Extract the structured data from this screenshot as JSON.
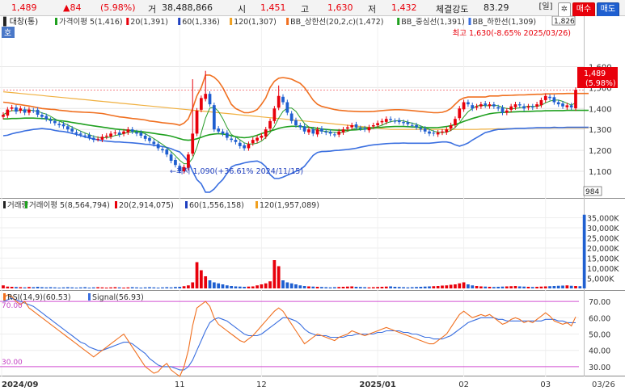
{
  "header": {
    "price": "1,489",
    "change": "▲84",
    "change_pct": "(5.98%)",
    "volume_label": "거",
    "volume": "38,488,866",
    "open_label": "시",
    "open": "1,451",
    "high_label": "고",
    "high": "1,630",
    "low_label": "저",
    "low": "1,432",
    "strength_label": "체결강도",
    "strength": "83.29",
    "period_button": "[일]",
    "buy_button": "매수",
    "sell_button": "매도"
  },
  "price_panel": {
    "title": "대창(통)",
    "quote_tag": "호",
    "legend": [
      {
        "text": "가격이평 5(1,416)",
        "color": "#1fa01f"
      },
      {
        "text": "20(1,391)",
        "color": "#e8000b"
      },
      {
        "text": "60(1,336)",
        "color": "#1f3fbf"
      },
      {
        "text": "120(1,307)",
        "color": "#f0a020"
      },
      {
        "text": "BB_상한선(20,2,c)(1,472)",
        "color": "#f07020"
      },
      {
        "text": "BB_중심선(1,391)",
        "color": "#1fa01f"
      },
      {
        "text": "BB_하한선(1,309)",
        "color": "#3a6fe0"
      }
    ],
    "max_annotation": "최고 1,630(-8.65% 2025/03/26)",
    "min_annotation": "최저 1,090(+36.61% 2024/11/15)",
    "axis_top_badge": "1,826",
    "axis_bottom_badge": "984",
    "current_price_badge": "1,489",
    "current_pct_badge": "(5.98%)"
  },
  "volume_panel": {
    "legend": [
      {
        "text": "거래량",
        "color": "#222222"
      },
      {
        "text": "거래이평 5(8,564,794)",
        "color": "#1fa01f"
      },
      {
        "text": "20(2,914,075)",
        "color": "#e8000b"
      },
      {
        "text": "60(1,556,158)",
        "color": "#1f3fbf"
      },
      {
        "text": "120(1,957,089)",
        "color": "#f0a020"
      }
    ],
    "ticks": [
      "35,000K",
      "30,000K",
      "25,000K",
      "20,000K",
      "15,000K",
      "10,000K",
      "5,000K"
    ]
  },
  "rsi_panel": {
    "legend": [
      {
        "text": "RSI(14,9)(60.53)",
        "color": "#f07020"
      },
      {
        "text": "Signal(56.93)",
        "color": "#3a6fe0"
      }
    ],
    "ticks": [
      "70.00",
      "60.00",
      "50.00",
      "40.00",
      "30.00"
    ],
    "left_labels": [
      "70.00",
      "30.00"
    ]
  },
  "x_labels": [
    "2024/09",
    "11",
    "12",
    "2025/01",
    "02",
    "03"
  ],
  "x_end_label": "03/26",
  "chart_data": [
    {
      "type": "candlestick",
      "title": "대창(통)",
      "ylim": [
        984,
        1826
      ],
      "yticks": [
        1100,
        1200,
        1300,
        1400,
        1500,
        1600
      ],
      "close": [
        1370,
        1395,
        1405,
        1385,
        1400,
        1380,
        1395,
        1390,
        1370,
        1360,
        1350,
        1340,
        1330,
        1320,
        1315,
        1300,
        1290,
        1280,
        1275,
        1270,
        1260,
        1250,
        1255,
        1265,
        1270,
        1280,
        1285,
        1275,
        1290,
        1300,
        1290,
        1280,
        1270,
        1255,
        1245,
        1230,
        1210,
        1200,
        1180,
        1150,
        1130,
        1100,
        1120,
        1180,
        1280,
        1390,
        1450,
        1470,
        1420,
        1300,
        1290,
        1280,
        1260,
        1250,
        1240,
        1220,
        1210,
        1230,
        1250,
        1260,
        1270,
        1300,
        1340,
        1400,
        1460,
        1430,
        1380,
        1340,
        1320,
        1310,
        1290,
        1300,
        1280,
        1300,
        1290,
        1285,
        1280,
        1275,
        1290,
        1300,
        1310,
        1320,
        1310,
        1305,
        1300,
        1310,
        1320,
        1330,
        1340,
        1350,
        1345,
        1340,
        1335,
        1330,
        1325,
        1320,
        1310,
        1300,
        1290,
        1280,
        1280,
        1285,
        1290,
        1300,
        1320,
        1350,
        1400,
        1430,
        1420,
        1400,
        1410,
        1420,
        1415,
        1420,
        1410,
        1400,
        1380,
        1390,
        1410,
        1420,
        1415,
        1400,
        1410,
        1405,
        1420,
        1440,
        1460,
        1450,
        1430,
        1420,
        1410,
        1415,
        1405,
        1489
      ],
      "highs": [
        [
          44,
          1540
        ],
        [
          47,
          1580
        ],
        [
          64,
          1510
        ],
        [
          138,
          1630
        ]
      ],
      "lows": [
        [
          41,
          1090
        ]
      ]
    },
    {
      "type": "line",
      "name_list": [
        "BB_상한선",
        "BB_중심선",
        "BB_하한선",
        "120"
      ],
      "bb_upper": [
        1430,
        1428,
        1425,
        1420,
        1418,
        1415,
        1412,
        1408,
        1404,
        1400,
        1398,
        1396,
        1395,
        1392,
        1390,
        1388,
        1385,
        1384,
        1383,
        1382,
        1381,
        1380,
        1378,
        1376,
        1372,
        1368,
        1364,
        1360,
        1358,
        1355,
        1352,
        1350,
        1348,
        1345,
        1340,
        1338,
        1335,
        1332,
        1330,
        1328,
        1325,
        1320,
        1330,
        1350,
        1400,
        1460,
        1500,
        1560,
        1560,
        1550,
        1530,
        1500,
        1460,
        1420,
        1400,
        1390,
        1380,
        1380,
        1385,
        1395,
        1420,
        1450,
        1500,
        1530,
        1545,
        1548,
        1545,
        1540,
        1530,
        1520,
        1500,
        1470,
        1440,
        1420,
        1410,
        1405,
        1400,
        1395,
        1392,
        1390,
        1388,
        1387,
        1386,
        1385,
        1385,
        1385,
        1386,
        1388,
        1390,
        1392,
        1393,
        1394,
        1394,
        1393,
        1392,
        1390,
        1388,
        1386,
        1384,
        1382,
        1380,
        1380,
        1382,
        1388,
        1400,
        1420,
        1440,
        1450,
        1455,
        1455,
        1455,
        1455,
        1455,
        1460,
        1460,
        1460,
        1462,
        1462,
        1463,
        1464,
        1465,
        1465,
        1466,
        1467,
        1468,
        1468,
        1470,
        1470,
        1470,
        1471,
        1471,
        1472,
        1472,
        1472,
        1472,
        1472,
        1472
      ],
      "bb_middle": [
        1350,
        1350,
        1352,
        1352,
        1353,
        1354,
        1354,
        1354,
        1353,
        1352,
        1350,
        1348,
        1345,
        1342,
        1340,
        1337,
        1333,
        1330,
        1327,
        1323,
        1320,
        1317,
        1314,
        1311,
        1308,
        1305,
        1302,
        1300,
        1298,
        1296,
        1294,
        1292,
        1290,
        1287,
        1284,
        1281,
        1278,
        1275,
        1272,
        1268,
        1262,
        1256,
        1250,
        1248,
        1250,
        1255,
        1262,
        1270,
        1275,
        1278,
        1280,
        1278,
        1275,
        1270,
        1265,
        1262,
        1260,
        1262,
        1266,
        1272,
        1280,
        1286,
        1292,
        1298,
        1305,
        1310,
        1313,
        1315,
        1315,
        1314,
        1312,
        1310,
        1308,
        1305,
        1302,
        1300,
        1298,
        1297,
        1296,
        1296,
        1296,
        1297,
        1298,
        1300,
        1302,
        1304,
        1306,
        1308,
        1310,
        1312,
        1313,
        1314,
        1314,
        1314,
        1313,
        1312,
        1311,
        1310,
        1309,
        1308,
        1308,
        1309,
        1311,
        1314,
        1318,
        1323,
        1330,
        1338,
        1345,
        1352,
        1358,
        1364,
        1370,
        1375,
        1378,
        1380,
        1381,
        1382,
        1383,
        1384,
        1385,
        1385,
        1386,
        1387,
        1388,
        1388,
        1389,
        1389,
        1390,
        1390,
        1390,
        1391,
        1391,
        1391,
        1391,
        1391,
        1391
      ],
      "bb_lower": [
        1270,
        1272,
        1279,
        1284,
        1288,
        1293,
        1296,
        1300,
        1302,
        1304,
        1302,
        1300,
        1295,
        1292,
        1290,
        1286,
        1281,
        1276,
        1271,
        1264,
        1259,
        1254,
        1250,
        1246,
        1244,
        1242,
        1240,
        1240,
        1238,
        1237,
        1236,
        1234,
        1232,
        1229,
        1228,
        1224,
        1221,
        1218,
        1214,
        1208,
        1199,
        1192,
        1170,
        1146,
        1100,
        1060,
        1040,
        1000,
        1000,
        1015,
        1040,
        1060,
        1090,
        1120,
        1130,
        1134,
        1140,
        1144,
        1147,
        1149,
        1140,
        1122,
        1084,
        1066,
        1065,
        1072,
        1081,
        1090,
        1100,
        1108,
        1124,
        1150,
        1176,
        1190,
        1194,
        1195,
        1196,
        1199,
        1200,
        1202,
        1204,
        1207,
        1210,
        1215,
        1219,
        1223,
        1226,
        1228,
        1230,
        1232,
        1233,
        1234,
        1234,
        1235,
        1234,
        1234,
        1234,
        1234,
        1234,
        1234,
        1236,
        1238,
        1240,
        1240,
        1236,
        1226,
        1220,
        1226,
        1235,
        1249,
        1261,
        1273,
        1285,
        1290,
        1296,
        1300,
        1300,
        1302,
        1303,
        1304,
        1305,
        1305,
        1306,
        1307,
        1308,
        1308,
        1308,
        1308,
        1310,
        1309,
        1309,
        1310,
        1310,
        1310,
        1310,
        1310,
        1310
      ],
      "ma120": [
        1480,
        1478,
        1476,
        1474,
        1472,
        1470,
        1468,
        1466,
        1464,
        1462,
        1460,
        1458,
        1456,
        1454,
        1452,
        1450,
        1448,
        1446,
        1444,
        1442,
        1440,
        1438,
        1436,
        1434,
        1432,
        1430,
        1428,
        1426,
        1424,
        1422,
        1420,
        1418,
        1416,
        1414,
        1412,
        1410,
        1408,
        1406,
        1404,
        1402,
        1400,
        1398,
        1396,
        1394,
        1392,
        1390,
        1388,
        1386,
        1384,
        1382,
        1380,
        1378,
        1376,
        1374,
        1372,
        1370,
        1368,
        1366,
        1364,
        1362,
        1360,
        1358,
        1356,
        1354,
        1352,
        1350,
        1348,
        1346,
        1344,
        1342,
        1340,
        1338,
        1336,
        1334,
        1332,
        1330,
        1328,
        1326,
        1324,
        1322,
        1320,
        1318,
        1316,
        1314,
        1312,
        1310,
        1308,
        1306,
        1304,
        1302,
        1300,
        1300,
        1300,
        1300,
        1300,
        1300,
        1300,
        1300,
        1300,
        1300,
        1300,
        1300,
        1300,
        1300,
        1300,
        1300,
        1300,
        1300,
        1300,
        1300,
        1300,
        1301,
        1301,
        1302,
        1302,
        1303,
        1303,
        1304,
        1304,
        1305,
        1305,
        1305,
        1305,
        1306,
        1306,
        1306,
        1306,
        1306,
        1307,
        1307,
        1307,
        1307,
        1307,
        1307,
        1307,
        1307,
        1307
      ]
    },
    {
      "type": "bar",
      "title": "거래량",
      "ylim": [
        0,
        38000
      ],
      "unit": "K",
      "values": [
        1500,
        900,
        800,
        700,
        600,
        500,
        700,
        600,
        800,
        600,
        500,
        600,
        500,
        400,
        500,
        600,
        500,
        400,
        500,
        600,
        400,
        500,
        600,
        500,
        400,
        500,
        600,
        500,
        400,
        500,
        600,
        500,
        400,
        500,
        600,
        500,
        400,
        500,
        600,
        500,
        700,
        800,
        1100,
        1500,
        3000,
        13000,
        9000,
        6000,
        4000,
        3000,
        2500,
        2000,
        1500,
        1200,
        1000,
        900,
        800,
        900,
        1000,
        1500,
        2000,
        2500,
        3500,
        14000,
        11000,
        4000,
        3000,
        2500,
        2000,
        1500,
        1200,
        1000,
        900,
        800,
        700,
        600,
        500,
        600,
        700,
        800,
        900,
        1000,
        800,
        700,
        600,
        500,
        600,
        700,
        800,
        900,
        1000,
        800,
        700,
        600,
        500,
        600,
        700,
        800,
        900,
        1000,
        1100,
        1200,
        1400,
        1500,
        1800,
        2000,
        2500,
        3000,
        2000,
        1500,
        1200,
        1000,
        900,
        800,
        700,
        800,
        900,
        1000,
        1100,
        1200,
        1000,
        900,
        800,
        700,
        800,
        900,
        1000,
        1100,
        1200,
        1300,
        1400,
        1500,
        1300,
        1200,
        1100,
        36500
      ]
    },
    {
      "type": "line",
      "title": "RSI",
      "ylim": [
        25,
        75
      ],
      "yticks": [
        70,
        60,
        50,
        40,
        30
      ],
      "rsi": [
        72,
        74,
        73,
        70,
        68,
        70,
        66,
        64,
        62,
        60,
        58,
        56,
        54,
        52,
        50,
        48,
        46,
        44,
        42,
        40,
        38,
        36,
        38,
        40,
        42,
        44,
        46,
        48,
        50,
        46,
        42,
        38,
        34,
        30,
        28,
        26,
        27,
        30,
        32,
        28,
        26,
        24,
        30,
        40,
        55,
        66,
        68,
        70,
        67,
        60,
        56,
        54,
        52,
        50,
        48,
        46,
        45,
        47,
        49,
        52,
        55,
        58,
        61,
        64,
        66,
        64,
        60,
        56,
        52,
        48,
        44,
        46,
        48,
        50,
        49,
        48,
        47,
        46,
        48,
        49,
        50,
        52,
        51,
        50,
        49,
        50,
        51,
        52,
        53,
        54,
        53,
        52,
        51,
        50,
        49,
        48,
        47,
        46,
        45,
        44,
        44,
        46,
        48,
        50,
        54,
        58,
        62,
        64,
        62,
        60,
        61,
        62,
        61,
        62,
        60,
        58,
        56,
        57,
        59,
        60,
        59,
        57,
        58,
        57,
        59,
        61,
        63,
        61,
        58,
        57,
        56,
        57,
        55,
        60.53
      ],
      "signal": [
        70,
        71,
        72,
        71,
        70,
        69,
        68,
        67,
        65,
        63,
        61,
        59,
        57,
        55,
        53,
        51,
        49,
        47,
        45,
        44,
        42,
        41,
        40,
        40,
        41,
        42,
        43,
        44,
        45,
        45,
        44,
        42,
        40,
        38,
        35,
        33,
        31,
        30,
        30,
        30,
        29,
        28,
        28,
        30,
        34,
        40,
        46,
        52,
        57,
        59,
        60,
        59,
        58,
        56,
        54,
        52,
        50,
        49,
        49,
        49,
        50,
        52,
        54,
        56,
        58,
        60,
        60,
        59,
        58,
        56,
        53,
        51,
        50,
        49,
        49,
        49,
        48,
        48,
        48,
        48,
        49,
        49,
        50,
        50,
        50,
        50,
        50,
        51,
        51,
        52,
        52,
        52,
        52,
        51,
        51,
        50,
        50,
        49,
        48,
        48,
        47,
        47,
        47,
        48,
        49,
        51,
        53,
        55,
        57,
        58,
        59,
        60,
        60,
        60,
        60,
        59,
        59,
        58,
        58,
        58,
        58,
        58,
        58,
        58,
        58,
        58,
        59,
        59,
        59,
        58,
        58,
        57,
        57,
        56.93
      ]
    }
  ]
}
